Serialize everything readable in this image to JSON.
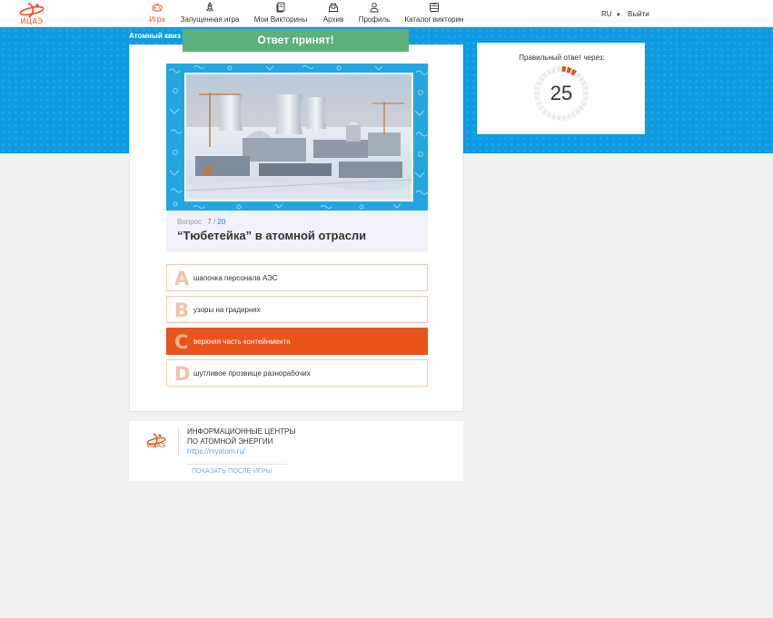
{
  "brand": {
    "logo_text": "ИЦАЭ"
  },
  "nav": {
    "items": [
      {
        "label": "Игра",
        "icon": "gamepad-icon",
        "active": true
      },
      {
        "label": "Запущенная игра",
        "icon": "rocket-icon",
        "active": false
      },
      {
        "label": "Мои Викторины",
        "icon": "documents-icon",
        "active": false
      },
      {
        "label": "Архив",
        "icon": "archive-icon",
        "active": false
      },
      {
        "label": "Профиль",
        "icon": "user-icon",
        "active": false
      },
      {
        "label": "Каталог викторин",
        "icon": "catalog-icon",
        "active": false
      }
    ],
    "language": "RU",
    "logout": "Выйти"
  },
  "quiz_tag": "Атомный квиз",
  "toast": "Ответ принят!",
  "question": {
    "label": "Вопрос",
    "current": "7",
    "separator": "/",
    "total": "20",
    "title": "“Тюбетейка” в атомной отрасли"
  },
  "answers": [
    {
      "letter": "A",
      "text": "шапочка персонала АЭС",
      "selected": false
    },
    {
      "letter": "B",
      "text": "узоры на градирнях",
      "selected": false
    },
    {
      "letter": "C",
      "text": "верхняя часть контейнмента",
      "selected": true
    },
    {
      "letter": "D",
      "text": "шутливое прозвище разнорабочих",
      "selected": false
    }
  ],
  "timer": {
    "title": "Правильный ответ через:",
    "value": "25",
    "remaining_fraction": 0.1
  },
  "footer": {
    "logo_text": "ИЦАЭ",
    "line1": "ИНФОРМАЦИОННЫЕ ЦЕНТРЫ",
    "line2": "ПО АТОМНОЙ ЭНЕРГИИ",
    "link": "https://myatom.ru/",
    "show_after": "ПОКАЗАТЬ ПОСЛЕ ИГРЫ"
  },
  "colors": {
    "accent": "#e8541c",
    "blue_band": "#0d9be2",
    "toast": "#5cb07a",
    "page_bg": "#f0f1f3"
  }
}
